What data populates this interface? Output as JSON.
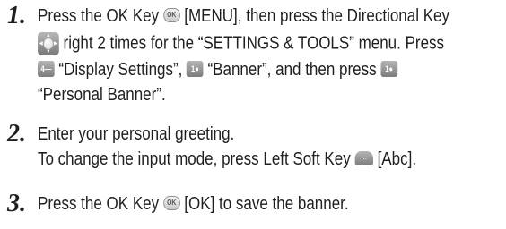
{
  "steps": [
    {
      "number": "1.",
      "l1": [
        "Press the OK Key",
        "[MENU], then press the Directional Key"
      ],
      "l2": [
        "right 2 times for the “SETTINGS & TOOLS” menu. Press"
      ],
      "l3": [
        "“Display Settings”,",
        "“Banner”, and then press"
      ],
      "l4": [
        "“Personal Banner”."
      ]
    },
    {
      "number": "2.",
      "l1": [
        "Enter your personal greeting."
      ],
      "l2": [
        "To change the input mode, press Left Soft Key",
        "[Abc]."
      ]
    },
    {
      "number": "3.",
      "l1": [
        "Press the OK Key",
        "[OK] to save the banner."
      ]
    }
  ],
  "icons": {
    "ok_key": "ok-key-icon",
    "directional_key": "directional-key-icon",
    "key_4": "key-4-icon",
    "key_1": "key-1-icon",
    "left_soft_key": "left-soft-key-icon"
  },
  "key_labels": {
    "ok": "OK",
    "key4": "4",
    "key1": "1"
  }
}
